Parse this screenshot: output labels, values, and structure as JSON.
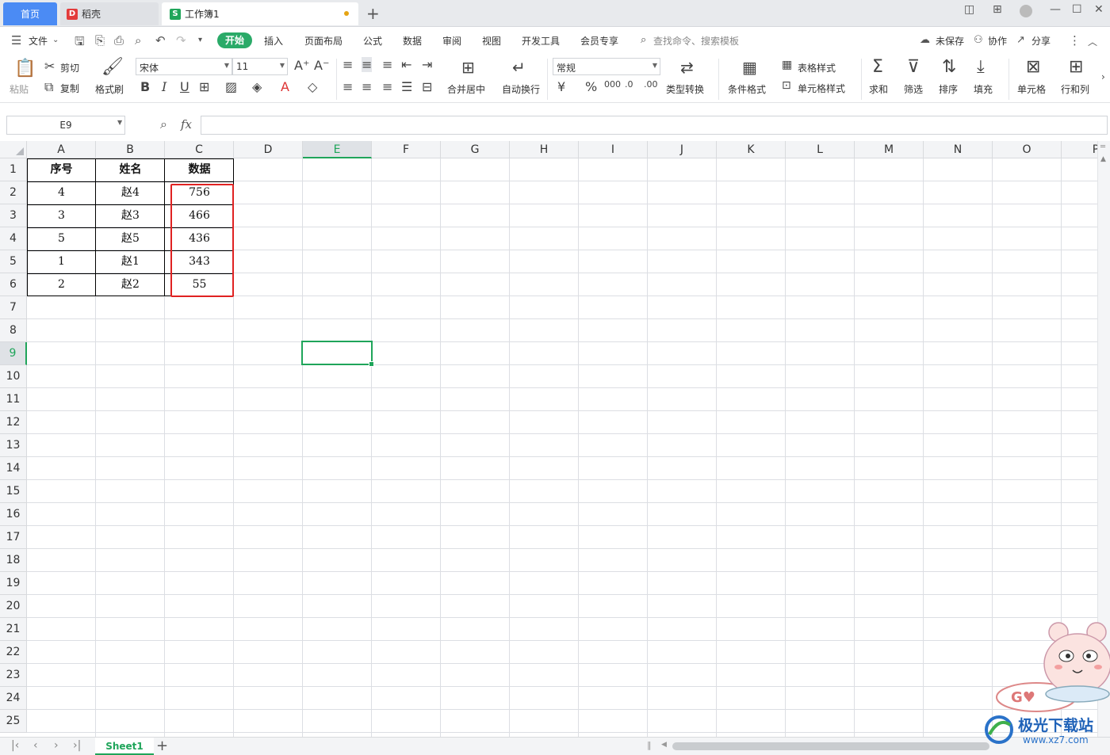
{
  "tabs": [
    {
      "label": "首页"
    },
    {
      "label": "稻壳"
    },
    {
      "label": "工作簿1"
    }
  ],
  "menu": {
    "file": "文件",
    "items": [
      "开始",
      "插入",
      "页面布局",
      "公式",
      "数据",
      "审阅",
      "视图",
      "开发工具",
      "会员专享"
    ],
    "search_placeholder": "查找命令、搜索模板",
    "unsaved": "未保存",
    "collab": "协作",
    "share": "分享"
  },
  "ribbon": {
    "paste": "粘贴",
    "cut": "剪切",
    "copy": "复制",
    "format_painter": "格式刷",
    "font_name": "宋体",
    "font_size": "11",
    "merge_center": "合并居中",
    "wrap_text": "自动换行",
    "number_format": "常规",
    "type_convert": "类型转换",
    "cond_format": "条件格式",
    "table_style": "表格样式",
    "cell_style": "单元格样式",
    "sum": "求和",
    "filter": "筛选",
    "sort": "排序",
    "fill": "填充",
    "cell": "单元格",
    "row_col": "行和列"
  },
  "formula_bar": {
    "name_box": "E9",
    "fx": "fx",
    "value": ""
  },
  "columns": [
    "A",
    "B",
    "C",
    "D",
    "E",
    "F",
    "G",
    "H",
    "I",
    "J",
    "K",
    "L",
    "M",
    "N",
    "O",
    "P"
  ],
  "rows": [
    "1",
    "2",
    "3",
    "4",
    "5",
    "6",
    "7",
    "8",
    "9",
    "10",
    "11",
    "12",
    "13",
    "14",
    "15",
    "16",
    "17",
    "18",
    "19",
    "20",
    "21",
    "22",
    "23",
    "24",
    "25"
  ],
  "selected_column": "E",
  "selected_row": "9",
  "table": {
    "headers": [
      "序号",
      "姓名",
      "数据"
    ],
    "rows": [
      [
        "4",
        "赵4",
        "756"
      ],
      [
        "3",
        "赵3",
        "466"
      ],
      [
        "5",
        "赵5",
        "436"
      ],
      [
        "1",
        "赵1",
        "343"
      ],
      [
        "2",
        "赵2",
        "55"
      ]
    ]
  },
  "sheets": [
    {
      "name": "Sheet1"
    }
  ],
  "watermark": {
    "title": "极光下载站",
    "url": "www.xz7.com"
  },
  "colors": {
    "accent": "#1fa55a",
    "highlight": "#e02222",
    "home_tab": "#4b8bf4"
  }
}
